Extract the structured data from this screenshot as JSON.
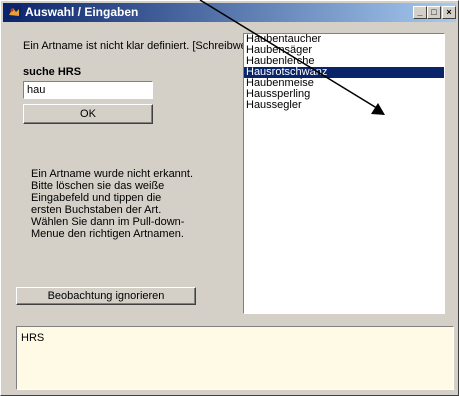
{
  "window": {
    "title": "Auswahl / Eingaben",
    "controls": {
      "minimize": "_",
      "maximize": "□",
      "close": "×"
    }
  },
  "form": {
    "message": "Ein Artname ist nicht klar definiert. [Schreibweie]",
    "search_label": "suche HRS",
    "search_value": "hau",
    "ok_label": "OK",
    "hint_lines": [
      "Ein Artname wurde nicht erkannt.",
      "Bitte löschen sie das weiße",
      "Eingabefeld und tippen die",
      "ersten Buchstaben der Art.",
      "Wählen Sie dann im Pull-down-",
      "Menue den richtigen Artnamen."
    ],
    "ignore_label": "Beobachtung ignorieren"
  },
  "species_list": {
    "items": [
      "Haubentaucher",
      "Haubensäger",
      "Haubenlerche",
      "Hausrotschwanz",
      "Haubenmeise",
      "Haussperling",
      "Haussegler"
    ],
    "selected_index": 3
  },
  "output": {
    "text": "HRS"
  },
  "colors": {
    "title_start": "#0a246a",
    "title_end": "#a6caf0",
    "selection": "#0a246a",
    "output_bg": "#fffae5"
  },
  "icons": {
    "app": "bird-app-icon",
    "annotation": "arrow-annotation"
  }
}
